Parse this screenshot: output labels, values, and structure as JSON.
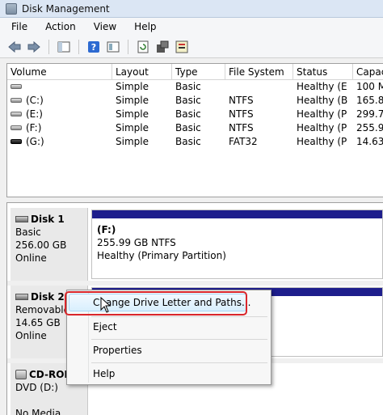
{
  "window": {
    "title": "Disk Management"
  },
  "menu": [
    "File",
    "Action",
    "View",
    "Help"
  ],
  "toolbar_icons": [
    "back-arrow-icon",
    "forward-arrow-icon",
    "console-tree-icon",
    "help-icon",
    "properties-icon",
    "refresh-icon",
    "settings-icon",
    "export-icon"
  ],
  "volume_table": {
    "columns": [
      "Volume",
      "Layout",
      "Type",
      "File System",
      "Status",
      "Capac"
    ],
    "rows": [
      {
        "volume": "",
        "layout": "Simple",
        "type": "Basic",
        "fs": "",
        "status": "Healthy (E",
        "capacity": "100 M"
      },
      {
        "volume": "(C:)",
        "layout": "Simple",
        "type": "Basic",
        "fs": "NTFS",
        "status": "Healthy (B",
        "capacity": "165.80"
      },
      {
        "volume": "(E:)",
        "layout": "Simple",
        "type": "Basic",
        "fs": "NTFS",
        "status": "Healthy (P",
        "capacity": "299.73"
      },
      {
        "volume": "(F:)",
        "layout": "Simple",
        "type": "Basic",
        "fs": "NTFS",
        "status": "Healthy (P",
        "capacity": "255.99"
      },
      {
        "volume": "(G:)",
        "layout": "Simple",
        "type": "Basic",
        "fs": "FAT32",
        "status": "Healthy (P",
        "capacity": "14.63"
      }
    ]
  },
  "disks": [
    {
      "name": "Disk 1",
      "type": "Basic",
      "size": "256.00 GB",
      "state": "Online",
      "partition": {
        "label": "(F:)",
        "size_fs": "255.99 GB NTFS",
        "status": "Healthy (Primary Partition)"
      }
    },
    {
      "name": "Disk 2",
      "type": "Removable",
      "size": "14.65 GB",
      "state": "Online"
    },
    {
      "name": "CD-ROM",
      "type": "DVD (D:)",
      "size": "",
      "state": "No Media"
    }
  ],
  "context_menu": {
    "items": [
      "Change Drive Letter and Paths...",
      "Eject",
      "Properties",
      "Help"
    ],
    "highlighted": "Change Drive Letter and Paths..."
  },
  "colors": {
    "partition_bar": "#1e1e8c",
    "highlight_outline": "#d9262b"
  }
}
